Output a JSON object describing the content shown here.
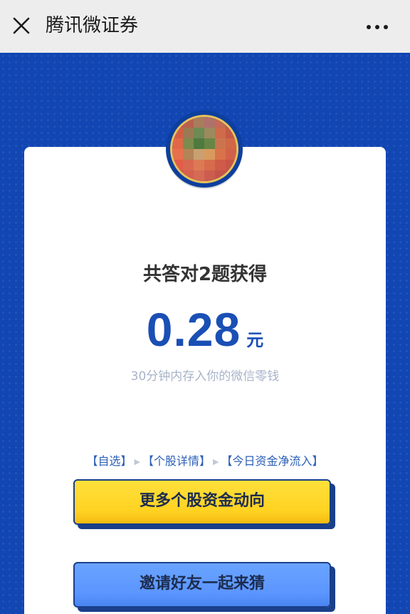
{
  "titlebar": {
    "title": "腾讯微证券",
    "close_icon": "close-icon",
    "more_icon": "more-icon"
  },
  "result": {
    "headline": "共答对2题获得",
    "amount": "0.28",
    "unit": "元",
    "note": "30分钟内存入你的微信零钱"
  },
  "breadcrumb": {
    "items": [
      "【自选】",
      "【个股详情】",
      "【今日资金净流入】"
    ],
    "separator": "▶"
  },
  "buttons": {
    "more_funds": "更多个股资金动向",
    "invite": "邀请好友一起来猜"
  },
  "colors": {
    "background": "#1146b3",
    "accent": "#1a4fb5",
    "button_primary": "#ffd322",
    "button_secondary": "#5b95ff"
  }
}
